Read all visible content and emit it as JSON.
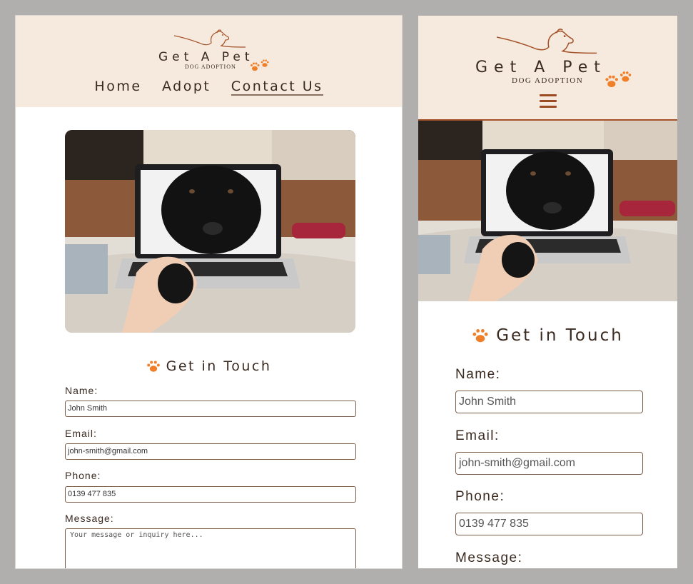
{
  "brand": {
    "name": "Get A Pet",
    "tagline": "DOG ADOPTION"
  },
  "nav": {
    "items": [
      {
        "label": "Home"
      },
      {
        "label": "Adopt"
      },
      {
        "label": "Contact Us"
      }
    ],
    "active": "Contact Us"
  },
  "contact": {
    "heading": "Get in Touch",
    "fields": {
      "name": {
        "label": "Name:",
        "value": "John Smith"
      },
      "email": {
        "label": "Email:",
        "value": "john-smith@gmail.com"
      },
      "phone": {
        "label": "Phone:",
        "value": "0139 477 835"
      },
      "message": {
        "label": "Message:",
        "placeholder": "Your message or inquiry here..."
      }
    }
  },
  "colors": {
    "header_bg": "#f5eadd",
    "accent_paw": "#f07f2a",
    "text": "#3a2a20",
    "border": "#7c5f4a",
    "backdrop": "#b1aeae"
  },
  "icons": {
    "menu": "hamburger-menu-icon",
    "paw": "paw-icon",
    "logo": "dog-line-logo-icon"
  }
}
